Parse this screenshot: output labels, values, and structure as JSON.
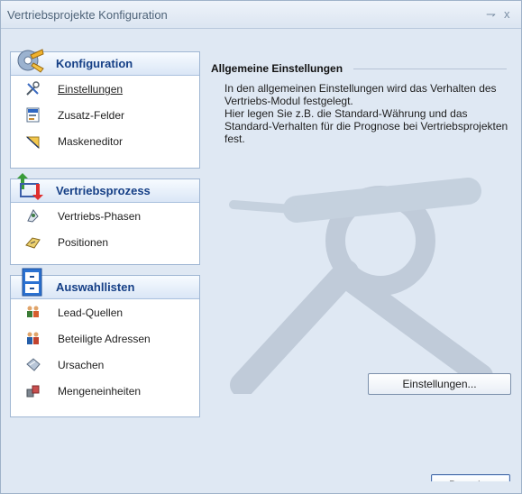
{
  "window": {
    "title": "Vertriebsprojekte Konfiguration",
    "pin_glyph": "⇁",
    "close_glyph": "x"
  },
  "sidebar": {
    "groups": [
      {
        "title": "Konfiguration",
        "icon": "gear-icon",
        "items": [
          {
            "label": "Einstellungen",
            "icon": "tools-icon"
          },
          {
            "label": "Zusatz-Felder",
            "icon": "form-icon"
          },
          {
            "label": "Maskeneditor",
            "icon": "ruler-icon"
          }
        ]
      },
      {
        "title": "Vertriebsprozess",
        "icon": "arrows-icon",
        "items": [
          {
            "label": "Vertriebs-Phasen",
            "icon": "phases-icon"
          },
          {
            "label": "Positionen",
            "icon": "positions-icon"
          }
        ]
      },
      {
        "title": "Auswahllisten",
        "icon": "cabinet-icon",
        "items": [
          {
            "label": "Lead-Quellen",
            "icon": "people-icon"
          },
          {
            "label": "Beteiligte Adressen",
            "icon": "contacts-icon"
          },
          {
            "label": "Ursachen",
            "icon": "hand-icon"
          },
          {
            "label": "Mengeneinheiten",
            "icon": "boxes-icon"
          }
        ]
      }
    ]
  },
  "main": {
    "section_title": "Allgemeine Einstellungen",
    "description": "In den allgemeinen Einstellungen wird das Verhalten des Vertriebs-Modul festgelegt.\nHier legen Sie z.B. die Standard-Währung und das Standard-Verhalten für die Prognose bei Vertriebsprojekten fest.",
    "settings_button": "Einstellungen...",
    "close_button": "Beenden"
  }
}
